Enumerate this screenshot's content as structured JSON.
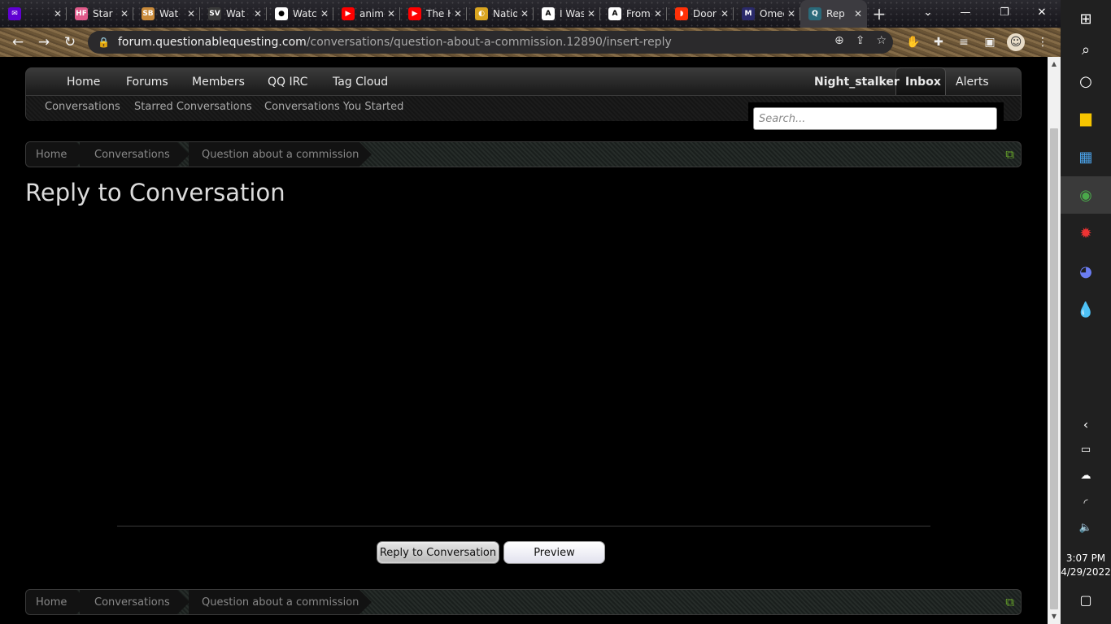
{
  "browser": {
    "tabs": [
      {
        "title": "",
        "favicon": "yahoo-mail-icon",
        "color": "#6001d2",
        "glyph": "✉"
      },
      {
        "title": "Star",
        "favicon": "hf-icon",
        "color": "#e05a8a",
        "glyph": "HF"
      },
      {
        "title": "Wat",
        "favicon": "sb-icon",
        "color": "#c98a3a",
        "glyph": "SB"
      },
      {
        "title": "Wat",
        "favicon": "sv-icon",
        "color": "#3a3a3a",
        "glyph": "SV"
      },
      {
        "title": "Watche",
        "favicon": "chat-icon",
        "color": "#ffffff",
        "glyph": "●"
      },
      {
        "title": "anime f",
        "favicon": "youtube-icon",
        "color": "#ff0000",
        "glyph": "▶"
      },
      {
        "title": "The Ho",
        "favicon": "youtube-icon",
        "color": "#ff0000",
        "glyph": "▶"
      },
      {
        "title": "NationS",
        "favicon": "nationstates-icon",
        "color": "#d9a520",
        "glyph": "◐"
      },
      {
        "title": "I Was A",
        "favicon": "a-icon",
        "color": "#ffffff",
        "glyph": "A"
      },
      {
        "title": "From M",
        "favicon": "a-icon",
        "color": "#ffffff",
        "glyph": "A"
      },
      {
        "title": "DoorDa",
        "favicon": "doordash-icon",
        "color": "#ff3008",
        "glyph": "◗"
      },
      {
        "title": "Omega",
        "favicon": "m-icon",
        "color": "#2a2a6a",
        "glyph": "M"
      },
      {
        "title": "Rep",
        "favicon": "qq-icon",
        "color": "#2a6a7a",
        "glyph": "Q",
        "active": true
      }
    ],
    "url_host": "forum.questionablequesting.com",
    "url_path": "/conversations/question-about-a-commission.12890/insert-reply"
  },
  "nav": {
    "primary": [
      "Home",
      "Forums",
      "Members",
      "QQ IRC",
      "Tag Cloud"
    ],
    "user": "Night_stalker",
    "inbox": "Inbox",
    "alerts": "Alerts",
    "secondary": [
      "Conversations",
      "Starred Conversations",
      "Conversations You Started"
    ],
    "search_placeholder": "Search..."
  },
  "breadcrumb": {
    "home": "Home",
    "section": "Conversations",
    "current": "Question about a commission"
  },
  "page_title": "Reply to Conversation",
  "buttons": {
    "reply": "Reply to Conversation",
    "preview": "Preview"
  },
  "taskbar": {
    "time": "3:07 PM",
    "date": "4/29/2022"
  },
  "colors": {
    "accent_green": "#6aaa2a",
    "page_bg": "#000000"
  }
}
